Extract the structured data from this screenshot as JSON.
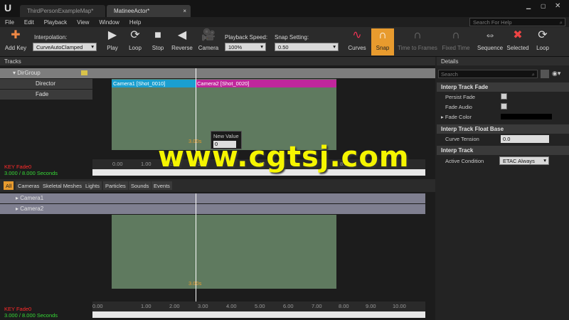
{
  "tabs": [
    {
      "label": "ThirdPersonExampleMap*"
    },
    {
      "label": "MatineeActor*"
    }
  ],
  "menu": [
    "File",
    "Edit",
    "Playback",
    "View",
    "Window",
    "Help"
  ],
  "search_help": {
    "placeholder": "Search For Help"
  },
  "toolbar": {
    "add_key": "Add Key",
    "interpolation_label": "Interpolation:",
    "interpolation_value": "CurveAutoClamped",
    "play": "Play",
    "loop": "Loop",
    "stop": "Stop",
    "reverse": "Reverse",
    "camera": "Camera",
    "playback_speed_label": "Playback Speed:",
    "playback_speed_value": "100%",
    "snap_setting_label": "Snap Setting:",
    "snap_setting_value": "0.50",
    "curves": "Curves",
    "snap": "Snap",
    "time_to_frames": "Time to Frames",
    "fixed_time": "Fixed Time",
    "sequence": "Sequence",
    "selected": "Selected",
    "loop2": "Loop"
  },
  "tracks_panel": {
    "title": "Tracks",
    "group": "DirGroup",
    "director": "Director",
    "fade": "Fade",
    "shot1": "Camera1 [Shot_0010]",
    "shot2": "Camera2 [Shot_0020]",
    "key_label": "KEY Fade0",
    "time_readout": "3.000 / 8.000 Seconds",
    "cursor_time": "3.00s",
    "popup_label": "New Value",
    "popup_value": "0"
  },
  "ruler_labels": [
    "0.00",
    "1.00",
    "2.00",
    "3.00",
    "4.00",
    "5.00",
    "6.00",
    "7.00",
    "8.00",
    "9.00",
    "10.00"
  ],
  "filter_tabs": [
    "All",
    "Cameras",
    "Skeletal Meshes",
    "Lights",
    "Particles",
    "Sounds",
    "Events"
  ],
  "group_tracks": [
    "Camera1",
    "Camera2"
  ],
  "details": {
    "title": "Details",
    "search_placeholder": "Search",
    "sect1": "Interp Track Fade",
    "persist_fade": "Persist Fade",
    "fade_audio": "Fade Audio",
    "fade_color": "Fade Color",
    "sect2": "Interp Track Float Base",
    "curve_tension": "Curve Tension",
    "curve_tension_value": "0.0",
    "sect3": "Interp Track",
    "active_condition": "Active Condition",
    "active_condition_value": "ETAC Always"
  },
  "watermark": "www.cgtsj.com",
  "colors": {
    "accent": "#e89b2e",
    "shot1": "#1a9fd0",
    "shot2": "#c0269c",
    "timeline": "#5f7a5f",
    "key_red": "#ff2a2a",
    "readout_green": "#36d936"
  }
}
